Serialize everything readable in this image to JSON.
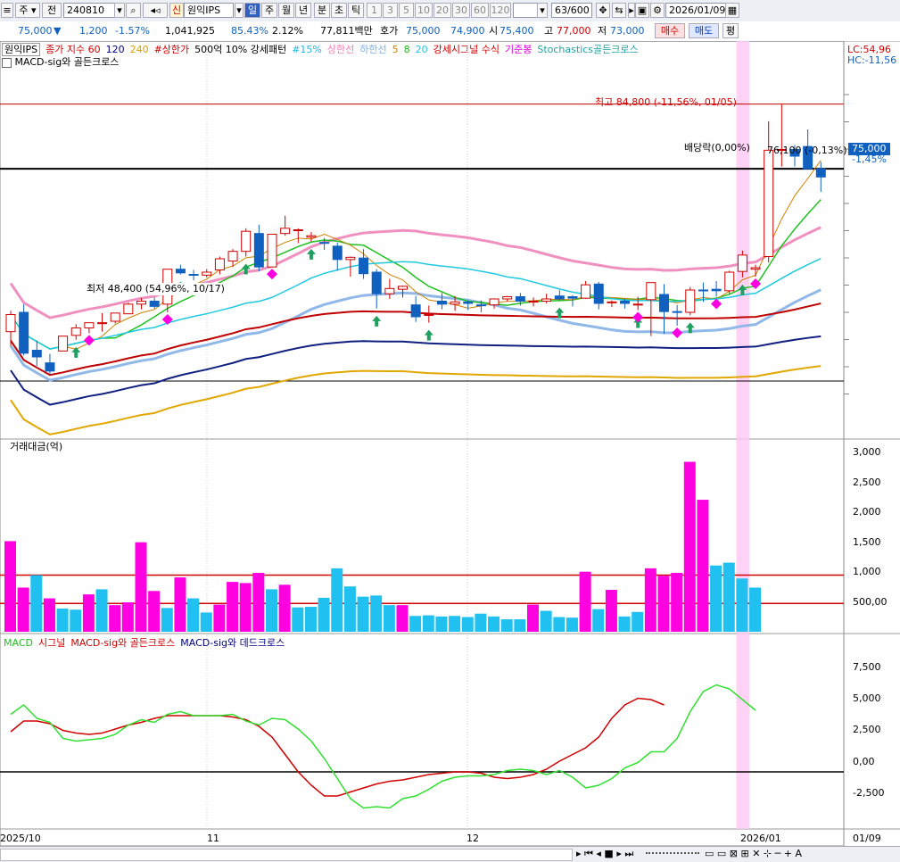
{
  "toolbar": {
    "market": "주",
    "period_type": "전",
    "code": "240810",
    "new_badge": "신",
    "name": "원익IPS",
    "day_button": "일",
    "periods": [
      "주",
      "월",
      "년",
      "분",
      "초",
      "틱"
    ],
    "minutes": [
      "1",
      "3",
      "5",
      "10",
      "20",
      "30",
      "60",
      "120"
    ],
    "count": "63",
    "count_total": "/600",
    "date": "2026/01/09"
  },
  "quote": {
    "price": "75,000",
    "down_mark": "▼",
    "change": "1,200",
    "change_rate": "-1.57%",
    "volume": "1,041,925",
    "ratio": "85.43%",
    "turnover": "2.12%",
    "amount": "77,811백만",
    "bid_label": "호가",
    "bid1": "75,000",
    "bid2": "74,900",
    "open_label": "시",
    "open": "75,400",
    "high_label": "고",
    "high": "77,000",
    "low_label": "저",
    "low": "73,000",
    "buy": "매수",
    "sell": "매도",
    "avg": "평"
  },
  "price_legend": {
    "name": "원익IPS",
    "items": [
      {
        "text": "종가 지수 60",
        "color": "#d00000"
      },
      {
        "text": "120",
        "color": "#000080"
      },
      {
        "text": "240",
        "color": "#d4a000"
      },
      {
        "text": "#상한가",
        "color": "#d00000"
      },
      {
        "text": "500억 10% 강세패턴",
        "color": "#000"
      },
      {
        "text": "#15%",
        "color": "#20b8e0"
      },
      {
        "text": "상한선",
        "color": "#f080b8"
      },
      {
        "text": "하한선",
        "color": "#80b0e0"
      },
      {
        "text": "5",
        "color": "#d08000"
      },
      {
        "text": "8",
        "color": "#20c020"
      },
      {
        "text": "20",
        "color": "#20c8e0"
      },
      {
        "text": "강세시그널 수식",
        "color": "#d00000"
      },
      {
        "text": "기준봉",
        "color": "#e000e0"
      },
      {
        "text": "Stochastics골든크로스",
        "color": "#20a0a0"
      }
    ],
    "sub": "MACD-sig와 골든크로스",
    "lc": "LC:54,96",
    "hc": "HC:-11,56"
  },
  "annotations": {
    "high_label": "최고 84,800 (-11,56%, 01/05)",
    "low_label": "최저 48,400 (54,96%, 10/17)",
    "dividend": "배당락(0,00%)",
    "last_label": "76,100 (-0,13%)",
    "axis_price": "75,000",
    "axis_change": "-1,45%"
  },
  "volume_panel": {
    "title": "거래대금(억)",
    "ticks": [
      "3,000",
      "2,500",
      "2,000",
      "1,500",
      "1,000",
      "500,00"
    ]
  },
  "macd_panel": {
    "legend": [
      {
        "text": "MACD",
        "color": "#20c020"
      },
      {
        "text": "시그널",
        "color": "#d00000"
      },
      {
        "text": "MACD-sig와 골든크로스",
        "color": "#d00000"
      },
      {
        "text": "MACD-sig와 데드크로스",
        "color": "#000080"
      }
    ],
    "ticks": [
      "7,500",
      "5,000",
      "2,500",
      "0,00",
      "-2,500"
    ]
  },
  "x_axis": {
    "labels": [
      "2025/10",
      "11",
      "12",
      "2026/01"
    ],
    "right": "01/09"
  },
  "colors": {
    "up": "#d00000",
    "down": "#1060c0",
    "vol_up": "#ff00e0",
    "vol_down": "#20c0f0"
  },
  "chart_data": {
    "type": "candlestick",
    "candles": [
      {
        "o": 54200,
        "h": 57000,
        "l": 52300,
        "c": 56500
      },
      {
        "o": 56800,
        "h": 57900,
        "l": 51000,
        "c": 51300
      },
      {
        "o": 51700,
        "h": 53000,
        "l": 49600,
        "c": 50800
      },
      {
        "o": 50000,
        "h": 51200,
        "l": 48400,
        "c": 48900
      },
      {
        "o": 51600,
        "h": 53600,
        "l": 51600,
        "c": 53600
      },
      {
        "o": 53700,
        "h": 55200,
        "l": 53100,
        "c": 54700
      },
      {
        "o": 54700,
        "h": 55400,
        "l": 54000,
        "c": 55400
      },
      {
        "o": 55400,
        "h": 56700,
        "l": 54200,
        "c": 55400
      },
      {
        "o": 55600,
        "h": 56300,
        "l": 55300,
        "c": 56700
      },
      {
        "o": 56600,
        "h": 58100,
        "l": 56600,
        "c": 57900
      },
      {
        "o": 57900,
        "h": 58700,
        "l": 57200,
        "c": 58300
      },
      {
        "o": 58300,
        "h": 58800,
        "l": 57300,
        "c": 57600
      },
      {
        "o": 57900,
        "h": 62600,
        "l": 56800,
        "c": 62600
      },
      {
        "o": 62600,
        "h": 63200,
        "l": 61900,
        "c": 62100
      },
      {
        "o": 61900,
        "h": 62500,
        "l": 61100,
        "c": 61800
      },
      {
        "o": 61800,
        "h": 62600,
        "l": 61500,
        "c": 62200
      },
      {
        "o": 62500,
        "h": 64300,
        "l": 61900,
        "c": 64000
      },
      {
        "o": 63700,
        "h": 65300,
        "l": 62900,
        "c": 65000
      },
      {
        "o": 65000,
        "h": 68100,
        "l": 64300,
        "c": 67700
      },
      {
        "o": 67400,
        "h": 68600,
        "l": 62300,
        "c": 62900
      },
      {
        "o": 62900,
        "h": 67300,
        "l": 62900,
        "c": 67300
      },
      {
        "o": 67400,
        "h": 69800,
        "l": 67100,
        "c": 68100
      },
      {
        "o": 67800,
        "h": 68100,
        "l": 66100,
        "c": 67900
      },
      {
        "o": 66900,
        "h": 67600,
        "l": 66300,
        "c": 67100
      },
      {
        "o": 66200,
        "h": 66800,
        "l": 65200,
        "c": 66100
      },
      {
        "o": 65700,
        "h": 66200,
        "l": 62400,
        "c": 63900
      },
      {
        "o": 63900,
        "h": 64300,
        "l": 61600,
        "c": 64200
      },
      {
        "o": 64100,
        "h": 65300,
        "l": 61300,
        "c": 62000
      },
      {
        "o": 62200,
        "h": 62600,
        "l": 57300,
        "c": 59300
      },
      {
        "o": 59300,
        "h": 61300,
        "l": 58600,
        "c": 60000
      },
      {
        "o": 59900,
        "h": 60400,
        "l": 58800,
        "c": 60300
      },
      {
        "o": 57800,
        "h": 59000,
        "l": 55500,
        "c": 56200
      },
      {
        "o": 56500,
        "h": 57700,
        "l": 55400,
        "c": 56500
      },
      {
        "o": 58300,
        "h": 59400,
        "l": 57200,
        "c": 57900
      },
      {
        "o": 57900,
        "h": 59000,
        "l": 57000,
        "c": 58200
      },
      {
        "o": 58200,
        "h": 58400,
        "l": 57100,
        "c": 58000
      },
      {
        "o": 57800,
        "h": 58400,
        "l": 56800,
        "c": 57700
      },
      {
        "o": 57800,
        "h": 58600,
        "l": 57300,
        "c": 58600
      },
      {
        "o": 58600,
        "h": 59000,
        "l": 58300,
        "c": 58900
      },
      {
        "o": 58900,
        "h": 59400,
        "l": 57700,
        "c": 58300
      },
      {
        "o": 58300,
        "h": 58800,
        "l": 57600,
        "c": 58300
      },
      {
        "o": 58300,
        "h": 59300,
        "l": 58000,
        "c": 58600
      },
      {
        "o": 59000,
        "h": 59800,
        "l": 58400,
        "c": 58600
      },
      {
        "o": 58900,
        "h": 59100,
        "l": 57600,
        "c": 58700
      },
      {
        "o": 58700,
        "h": 61000,
        "l": 58600,
        "c": 60500
      },
      {
        "o": 60600,
        "h": 60900,
        "l": 57200,
        "c": 58000
      },
      {
        "o": 58200,
        "h": 58400,
        "l": 57500,
        "c": 58200
      },
      {
        "o": 58300,
        "h": 58600,
        "l": 57300,
        "c": 58000
      },
      {
        "o": 57800,
        "h": 58900,
        "l": 57100,
        "c": 57900
      },
      {
        "o": 58500,
        "h": 59600,
        "l": 53600,
        "c": 60800
      },
      {
        "o": 59200,
        "h": 60600,
        "l": 53900,
        "c": 56900
      },
      {
        "o": 56900,
        "h": 57800,
        "l": 55000,
        "c": 56800
      },
      {
        "o": 56800,
        "h": 60200,
        "l": 56400,
        "c": 59800
      },
      {
        "o": 59800,
        "h": 60800,
        "l": 58200,
        "c": 59700
      },
      {
        "o": 59900,
        "h": 61000,
        "l": 58900,
        "c": 59700
      },
      {
        "o": 59700,
        "h": 62400,
        "l": 59300,
        "c": 62200
      },
      {
        "o": 62300,
        "h": 65100,
        "l": 61500,
        "c": 64500
      },
      {
        "o": 62600,
        "h": 63200,
        "l": 61600,
        "c": 62800
      },
      {
        "o": 64300,
        "h": 82500,
        "l": 63500,
        "c": 78600
      },
      {
        "o": 78600,
        "h": 84800,
        "l": 76400,
        "c": 78700
      },
      {
        "o": 78700,
        "h": 79300,
        "l": 76400,
        "c": 77800
      },
      {
        "o": 79100,
        "h": 81400,
        "l": 76200,
        "c": 76100
      },
      {
        "o": 76100,
        "h": 77000,
        "l": 73000,
        "c": 75000
      }
    ],
    "trading_value": [
      1600,
      780,
      1000,
      590,
      410,
      390,
      660,
      750,
      470,
      520,
      1580,
      720,
      420,
      960,
      590,
      340,
      480,
      880,
      860,
      1040,
      750,
      830,
      430,
      440,
      600,
      1120,
      800,
      620,
      640,
      470,
      470,
      280,
      290,
      270,
      280,
      260,
      320,
      270,
      220,
      220,
      480,
      370,
      260,
      250,
      1060,
      400,
      740,
      270,
      350,
      1120,
      990,
      1040,
      3000,
      2330,
      1170,
      1220,
      940,
      780,
      0,
      0,
      0,
      0,
      0
    ],
    "trading_value_up": [
      1,
      1,
      0,
      1,
      0,
      0,
      1,
      0,
      1,
      1,
      1,
      1,
      0,
      1,
      0,
      0,
      1,
      1,
      1,
      1,
      0,
      1,
      0,
      0,
      0,
      0,
      0,
      0,
      0,
      0,
      1,
      0,
      0,
      0,
      0,
      0,
      0,
      0,
      0,
      0,
      1,
      0,
      0,
      0,
      1,
      0,
      1,
      0,
      0,
      1,
      1,
      1,
      1,
      1,
      0,
      0,
      0,
      0,
      0,
      0,
      0,
      0,
      0
    ],
    "macd": [
      4300,
      5000,
      4000,
      3700,
      2500,
      2300,
      2400,
      2500,
      2800,
      3500,
      3900,
      3700,
      4300,
      4500,
      4200,
      4200,
      4200,
      4300,
      3800,
      3500,
      4000,
      3900,
      3200,
      2300,
      1000,
      -500,
      -2000,
      -2700,
      -2600,
      -2700,
      -2000,
      -1800,
      -1300,
      -700,
      -400,
      -300,
      -300,
      -200,
      100,
      200,
      100,
      -200,
      100,
      -400,
      -1200,
      -1000,
      -500,
      300,
      700,
      1500,
      1500,
      2500,
      4500,
      6000,
      6500,
      6200,
      5400,
      4600
    ],
    "signal": [
      3000,
      3800,
      3800,
      3600,
      3100,
      2900,
      2800,
      2900,
      3200,
      3500,
      3700,
      4000,
      4200,
      4200,
      4200,
      4200,
      4200,
      4100,
      3900,
      3400,
      2600,
      1300,
      0,
      -1000,
      -1800,
      -1800,
      -1500,
      -1200,
      -900,
      -700,
      -600,
      -400,
      -200,
      -100,
      0,
      0,
      -100,
      -400,
      -500,
      -400,
      -200,
      200,
      800,
      1300,
      1800,
      2600,
      4000,
      5000,
      5500,
      5400,
      5000
    ],
    "y_range": [
      40000,
      88000
    ],
    "volume_range": [
      0,
      3150
    ],
    "macd_range": [
      -4000,
      9000
    ]
  }
}
